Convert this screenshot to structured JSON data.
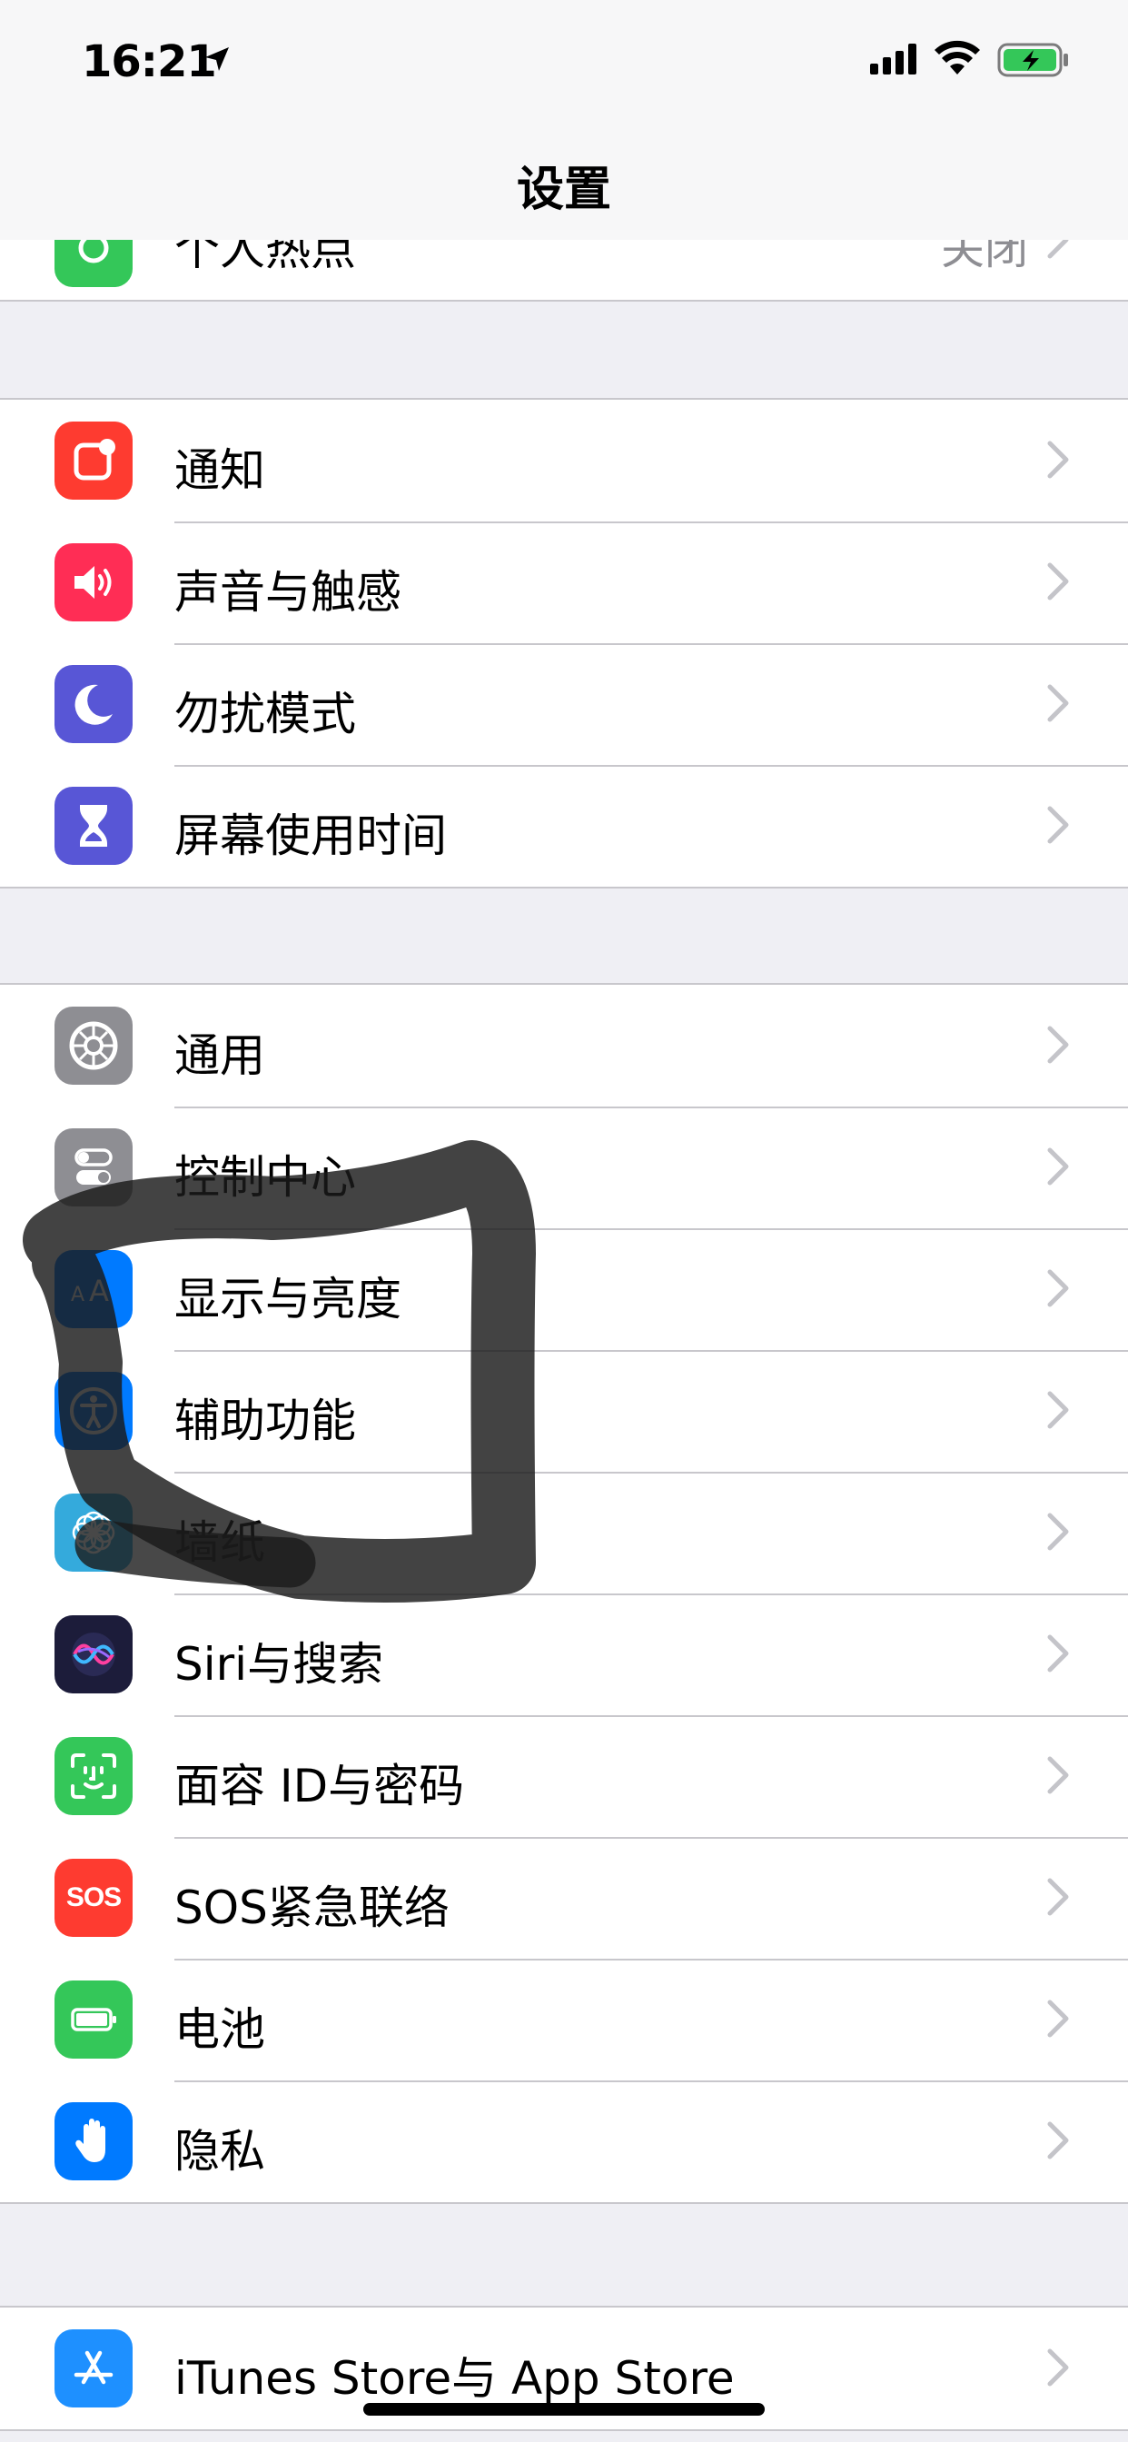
{
  "status_bar": {
    "time": "16:21"
  },
  "nav": {
    "title": "设置"
  },
  "peek_row": {
    "label": "个人热点",
    "value": "关闭"
  },
  "groups": [
    {
      "items": [
        {
          "label": "通知",
          "icon": "notifications-icon",
          "color": "#fe3b30"
        },
        {
          "label": "声音与触感",
          "icon": "speaker-icon",
          "color": "#ff2d55"
        },
        {
          "label": "勿扰模式",
          "icon": "moon-icon",
          "color": "#5856d6"
        },
        {
          "label": "屏幕使用时间",
          "icon": "hourglass-icon",
          "color": "#5856d6"
        }
      ]
    },
    {
      "items": [
        {
          "label": "通用",
          "icon": "gear-icon",
          "color": "#8e8e93"
        },
        {
          "label": "控制中心",
          "icon": "toggles-icon",
          "color": "#8e8e93"
        },
        {
          "label": "显示与亮度",
          "icon": "text-size-icon",
          "color": "#007aff"
        },
        {
          "label": "辅助功能",
          "icon": "accessibility-icon",
          "color": "#007aff"
        },
        {
          "label": "墙纸",
          "icon": "flower-icon",
          "color": "#34aadc"
        },
        {
          "label": "Siri与搜索",
          "icon": "siri-icon",
          "color": "#1c1c3a"
        },
        {
          "label": "面容 ID与密码",
          "icon": "face-id-icon",
          "color": "#34c759"
        },
        {
          "label": "SOS紧急联络",
          "icon": "sos-icon",
          "color": "#fe3b30",
          "icon_text": "SOS"
        },
        {
          "label": "电池",
          "icon": "battery-icon",
          "color": "#34c759"
        },
        {
          "label": "隐私",
          "icon": "hand-icon",
          "color": "#007aff"
        }
      ]
    },
    {
      "items": [
        {
          "label": "iTunes Store与 App Store",
          "icon": "app-store-icon",
          "color": "#1e90ff"
        }
      ]
    }
  ]
}
